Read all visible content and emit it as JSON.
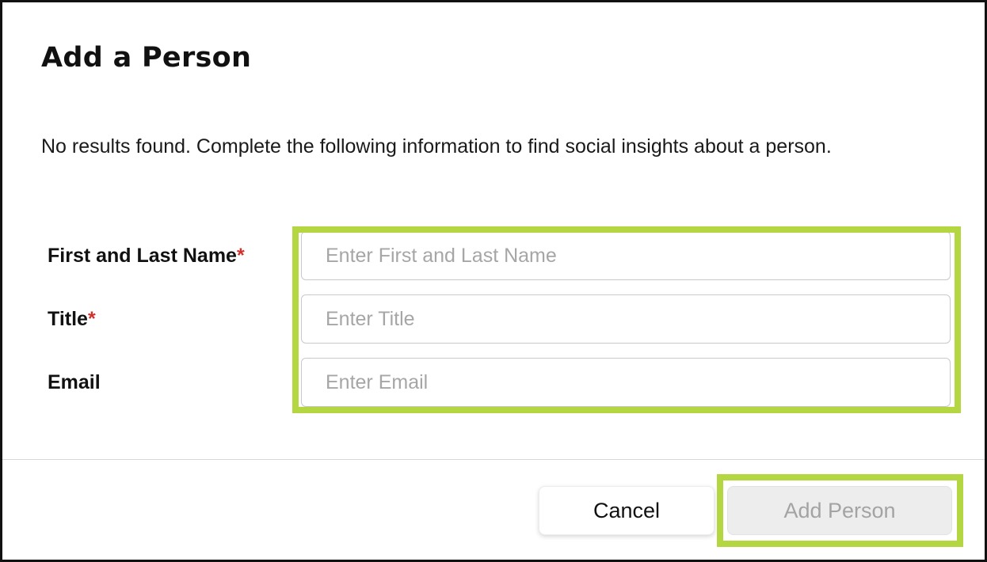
{
  "dialog": {
    "title": "Add a Person",
    "message": "No results found. Complete the following information to find social insights about a person."
  },
  "form": {
    "fields": [
      {
        "label": "First and Last Name",
        "required_mark": "*",
        "placeholder": "Enter First and Last Name",
        "value": ""
      },
      {
        "label": "Title",
        "required_mark": "*",
        "placeholder": "Enter Title",
        "value": ""
      },
      {
        "label": "Email",
        "placeholder": "Enter Email",
        "value": ""
      }
    ]
  },
  "footer": {
    "cancel_label": "Cancel",
    "add_label": "Add Person",
    "add_disabled": true
  },
  "colors": {
    "highlight": "#b4d641",
    "required": "#d0312d",
    "disabled_button_bg": "#ededed",
    "disabled_button_text": "#a3a3a3"
  }
}
